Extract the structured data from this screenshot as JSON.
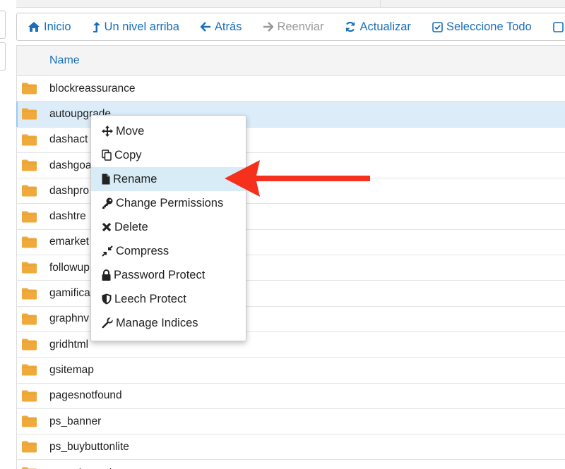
{
  "toolbar": {
    "home": "Inicio",
    "up": "Un nivel arriba",
    "back": "Atrás",
    "forward": "Reenviar",
    "refresh": "Actualizar",
    "select_all": "Seleccione Todo"
  },
  "table": {
    "header_name": "Name",
    "rows": [
      "blockreassurance",
      "autoupgrade",
      "dashact",
      "dashgoa",
      "dashpro",
      "dashtre",
      "emarket",
      "followup",
      "gamifica",
      "graphnv",
      "gridhtml",
      "gsitemap",
      "pagesnotfound",
      "ps_banner",
      "ps_buybuttonlite",
      "ps_categorytree"
    ]
  },
  "context_menu": {
    "move": "Move",
    "copy": "Copy",
    "rename": "Rename",
    "change_permissions": "Change Permissions",
    "delete": "Delete",
    "compress": "Compress",
    "password_protect": "Password Protect",
    "leech_protect": "Leech Protect",
    "manage_indices": "Manage Indices"
  },
  "colors": {
    "link_blue": "#1a6fb7",
    "folder_orange": "#f0a93b",
    "selected_row": "#dcedf9",
    "arrow_red": "#f5301c"
  }
}
